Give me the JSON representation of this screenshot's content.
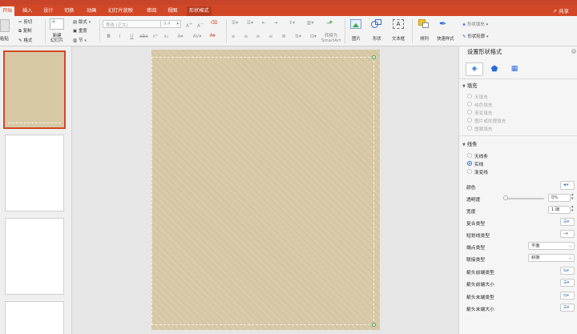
{
  "tabs": [
    "开始",
    "插入",
    "设计",
    "切换",
    "动画",
    "幻灯片放映",
    "审阅",
    "视图",
    "形状格式"
  ],
  "share_label": "共享",
  "ribbon": {
    "paste_label": "粘贴",
    "cut_label": "剪切",
    "copy_label": "复制",
    "format_painter_label": "格式",
    "new_slide_label": "新建\n幻灯片",
    "layout_label": "版式",
    "reset_label": "重置",
    "section_label": "节",
    "font_name_placeholder": "等线 (正文)",
    "font_size_placeholder": "9.4",
    "convert_smartart_label": "转换为\nSmartArt",
    "picture_label": "图片",
    "shape_label": "形状",
    "textbox_label": "文本框",
    "arrange_label": "排列",
    "quick_styles_label": "快速样式",
    "shape_fill_label": "形状填充",
    "shape_outline_label": "形状轮廓"
  },
  "panel": {
    "title": "设置形状格式",
    "fill_section": "填充",
    "fill_options": [
      "无填充",
      "纯色填充",
      "渐变填充",
      "图片或纹理填充",
      "图案填充"
    ],
    "line_section": "线条",
    "line_options": [
      "无线条",
      "实线",
      "渐变线"
    ],
    "line_selected": 1,
    "color_label": "颜色",
    "transparency_label": "透明度",
    "transparency_value": "0%",
    "width_label": "宽度",
    "width_value": "1 磅",
    "compound_label": "复合类型",
    "dash_label": "短划线类型",
    "cap_label": "端点类型",
    "cap_value": "平面",
    "join_label": "联接类型",
    "join_value": "斜接",
    "arrow_begin_type_label": "箭头前端类型",
    "arrow_begin_size_label": "箭头前端大小",
    "arrow_end_type_label": "箭头末端类型",
    "arrow_end_size_label": "箭头末端大小"
  },
  "colors": {
    "brand": "#d24726",
    "slide_bg": "#d8c9a6",
    "handle": "#3fa64a",
    "radio_selected": "#2e6ad8"
  }
}
